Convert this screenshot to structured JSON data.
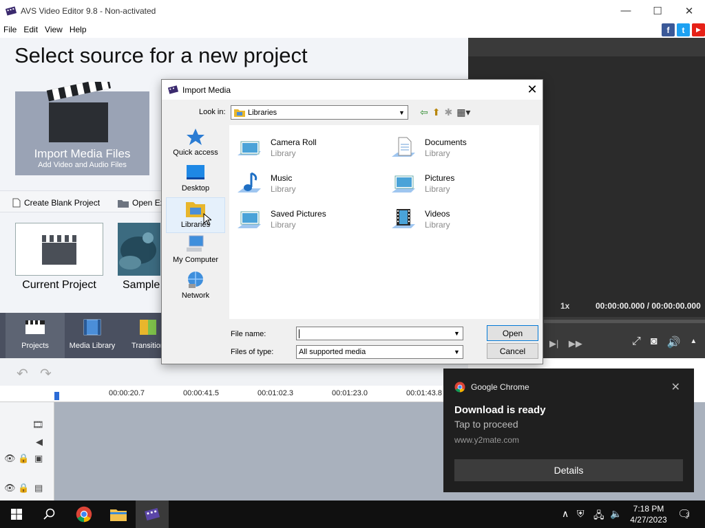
{
  "window": {
    "title": "AVS Video Editor 9.8 - Non-activated",
    "minimize": "—",
    "maximize": "☐",
    "close": "✕"
  },
  "menu": [
    "File",
    "Edit",
    "View",
    "Help"
  ],
  "social": {
    "facebook": "f",
    "twitter": "t",
    "youtube": "▶"
  },
  "start": {
    "headline": "Select source for a new project",
    "import_title": "Import Media Files",
    "import_sub": "Add Video and Audio Files",
    "create_blank": "Create Blank Project",
    "open_existing": "Open Ex",
    "current_project": "Current Project",
    "sample": "Sample"
  },
  "preview": {
    "speed": "1x",
    "time": "00:00:00.000 / 00:00:00.000"
  },
  "toolbar": [
    {
      "label": "Projects",
      "active": true
    },
    {
      "label": "Media Library",
      "active": false
    },
    {
      "label": "Transition",
      "active": false
    }
  ],
  "timeline": {
    "ticks": [
      "00:00:20.7",
      "00:00:41.5",
      "00:01:02.3",
      "00:01:23.0",
      "00:01:43.8"
    ]
  },
  "dialog": {
    "title": "Import Media",
    "look_in_label": "Look in:",
    "look_in_value": "Libraries",
    "places": [
      "Quick access",
      "Desktop",
      "Libraries",
      "My Computer",
      "Network"
    ],
    "items": [
      {
        "name": "Camera Roll",
        "type": "Library",
        "icon": "camera-roll-icon"
      },
      {
        "name": "Documents",
        "type": "Library",
        "icon": "documents-icon"
      },
      {
        "name": "Music",
        "type": "Library",
        "icon": "music-icon"
      },
      {
        "name": "Pictures",
        "type": "Library",
        "icon": "pictures-icon"
      },
      {
        "name": "Saved Pictures",
        "type": "Library",
        "icon": "saved-pictures-icon"
      },
      {
        "name": "Videos",
        "type": "Library",
        "icon": "videos-icon"
      }
    ],
    "file_name_label": "File name:",
    "file_name_value": "",
    "files_of_type_label": "Files of type:",
    "files_of_type_value": "All supported media",
    "open": "Open",
    "cancel": "Cancel"
  },
  "notification": {
    "app": "Google Chrome",
    "title": "Download is ready",
    "subtitle": "Tap to proceed",
    "url": "www.y2mate.com",
    "button": "Details"
  },
  "taskbar": {
    "time": "7:18 PM",
    "date": "4/27/2023",
    "notifications": "3"
  },
  "colors": {
    "toolbar": "#4a5060",
    "preview": "#2b2b2b",
    "timeline": "#a9b1bd",
    "toast": "#1f1f1f",
    "accent": "#0078d7"
  }
}
